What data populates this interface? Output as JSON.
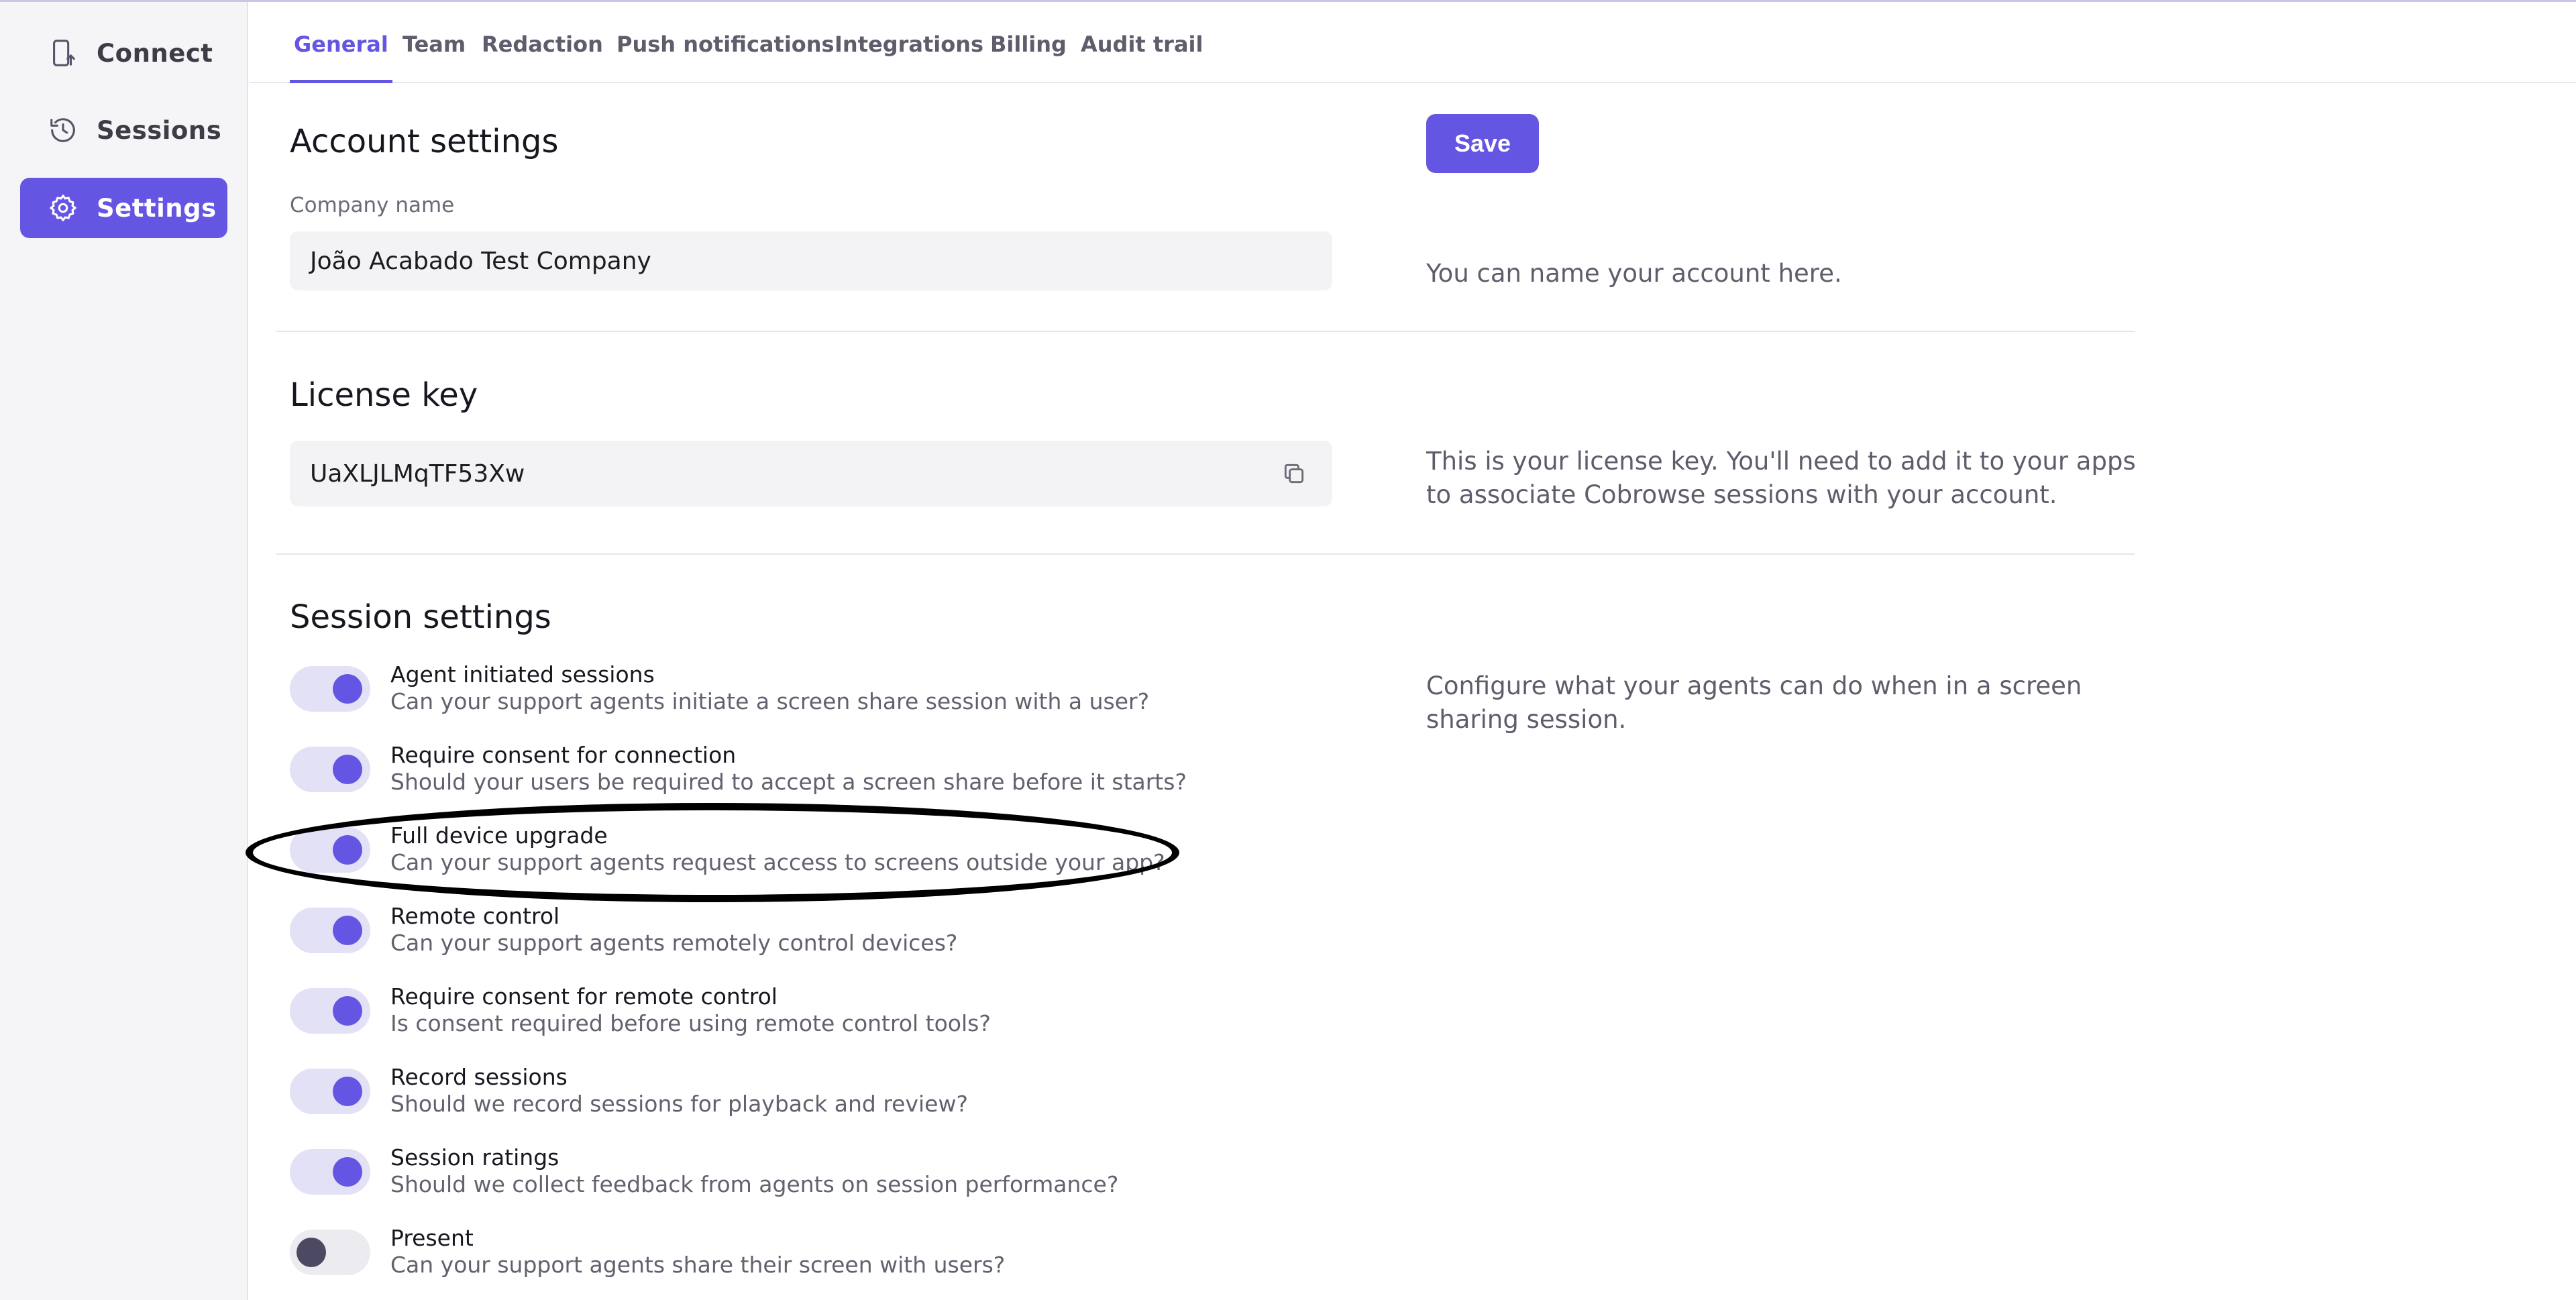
{
  "sidebar": {
    "items": [
      {
        "label": "Connect",
        "icon": "phone-upload-icon"
      },
      {
        "label": "Sessions",
        "icon": "history-icon"
      },
      {
        "label": "Settings",
        "icon": "gear-icon",
        "active": true
      }
    ]
  },
  "tabs": [
    {
      "label": "General",
      "active": true
    },
    {
      "label": "Team"
    },
    {
      "label": "Redaction"
    },
    {
      "label": "Push notifications"
    },
    {
      "label": "Integrations"
    },
    {
      "label": "Billing"
    },
    {
      "label": "Audit trail"
    }
  ],
  "account": {
    "title": "Account settings",
    "company_label": "Company name",
    "company_value": "João Acabado Test Company",
    "save_label": "Save",
    "help": "You can name your account here."
  },
  "license": {
    "title": "License key",
    "value": "UaXLJLMqTF53Xw",
    "help_line1": "This is your license key. You'll need to add it to your apps",
    "help_line2": "to associate Cobrowse sessions with your account."
  },
  "session": {
    "title": "Session settings",
    "help_line1": "Configure what your agents can do when in a screen",
    "help_line2": "sharing session.",
    "toggles": [
      {
        "title": "Agent initiated sessions",
        "desc": "Can your support agents initiate a screen share session with a user?",
        "on": true
      },
      {
        "title": "Require consent for connection",
        "desc": "Should your users be required to accept a screen share before it starts?",
        "on": true
      },
      {
        "title": "Full device upgrade",
        "desc": "Can your support agents request access to screens outside your app?",
        "on": true
      },
      {
        "title": "Remote control",
        "desc": "Can your support agents remotely control devices?",
        "on": true
      },
      {
        "title": "Require consent for remote control",
        "desc": "Is consent required before using remote control tools?",
        "on": true
      },
      {
        "title": "Record sessions",
        "desc": "Should we record sessions for playback and review?",
        "on": true
      },
      {
        "title": "Session ratings",
        "desc": "Should we collect feedback from agents on session performance?",
        "on": true
      },
      {
        "title": "Present",
        "desc": "Can your support agents share their screen with users?",
        "on": false
      }
    ]
  },
  "colors": {
    "accent": "#6555e3",
    "toggle_track_on": "#e3e1f6",
    "toggle_knob_off": "#4c4a62"
  }
}
